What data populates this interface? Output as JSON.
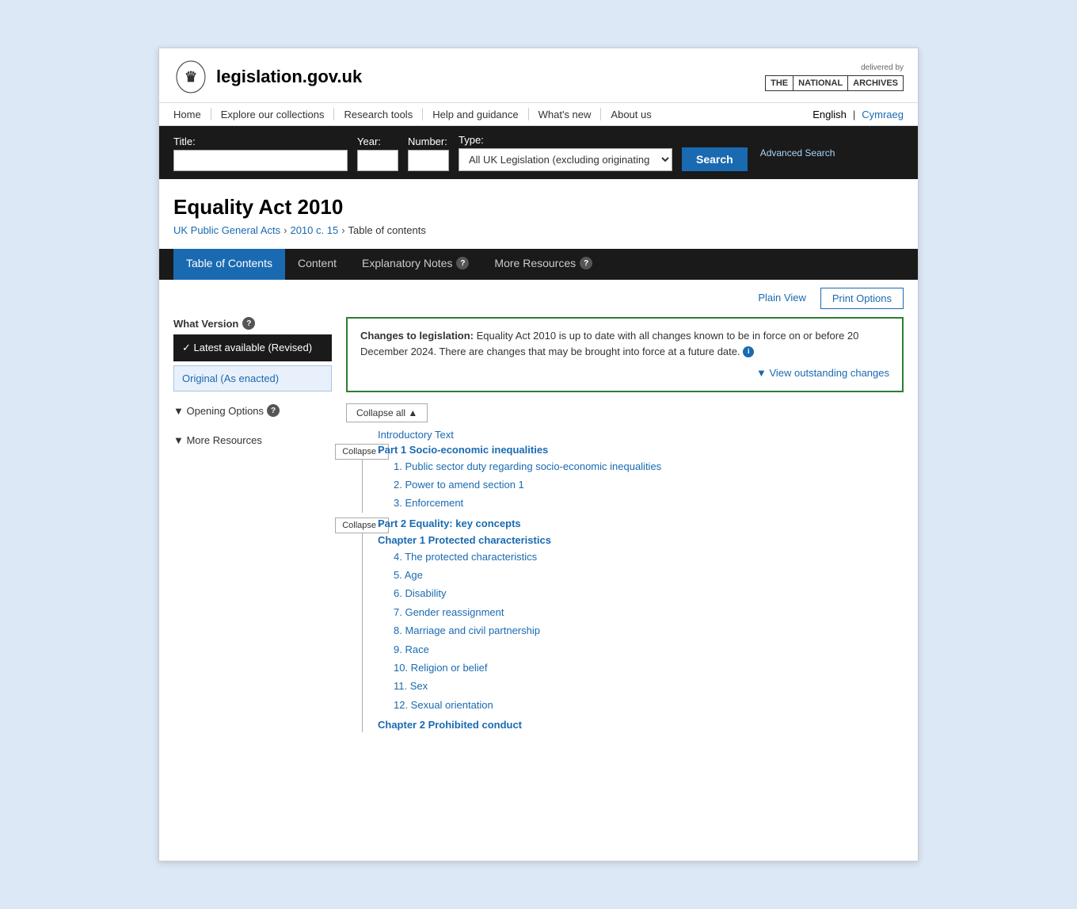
{
  "site": {
    "name_bold": "legislation",
    "name_rest": ".gov.uk",
    "delivered_by": "delivered by",
    "na_parts": [
      "THE",
      "NATIONAL",
      "ARCHIVES"
    ]
  },
  "nav": {
    "links": [
      "Home",
      "Explore our collections",
      "Research tools",
      "Help and guidance",
      "What's new",
      "About us"
    ],
    "lang_en": "English",
    "lang_cy": "Cymraeg"
  },
  "search": {
    "title_label": "Title:",
    "year_label": "Year:",
    "number_label": "Number:",
    "type_label": "Type:",
    "type_default": "All UK Legislation (excluding originating from the EU)",
    "search_btn": "Search",
    "advanced_link": "Advanced Search"
  },
  "page": {
    "title": "Equality Act 2010",
    "breadcrumb": [
      "UK Public General Acts",
      "2010 c. 15",
      "Table of contents"
    ]
  },
  "tabs": [
    {
      "label": "Table of Contents",
      "active": true,
      "help": false
    },
    {
      "label": "Content",
      "active": false,
      "help": false
    },
    {
      "label": "Explanatory Notes",
      "active": false,
      "help": true
    },
    {
      "label": "More Resources",
      "active": false,
      "help": true
    }
  ],
  "view_options": {
    "plain_view": "Plain View",
    "print_options": "Print Options"
  },
  "sidebar": {
    "what_version_label": "What Version",
    "version_latest": "✓ Latest available (Revised)",
    "version_original": "Original (As enacted)",
    "opening_options_label": "▼ Opening Options",
    "more_resources_label": "▼ More Resources"
  },
  "changes_box": {
    "title": "Changes to legislation:",
    "body": "Equality Act 2010 is up to date with all changes known to be in force on or before 20 December 2024. There are changes that may be brought into force at a future date.",
    "view_outstanding": "▼ View outstanding changes"
  },
  "toc": {
    "collapse_all": "Collapse all ▲",
    "collapse": "Collapse ▲",
    "introductory_text": "Introductory Text",
    "parts": [
      {
        "title": "Part 1 Socio-economic inequalities",
        "items": [
          "1. Public sector duty regarding socio-economic inequalities",
          "2. Power to amend section 1",
          "3. Enforcement"
        ],
        "chapters": []
      },
      {
        "title": "Part 2 Equality: key concepts",
        "items": [],
        "chapters": [
          {
            "title": "Chapter 1 Protected characteristics",
            "items": [
              "4. The protected characteristics",
              "5. Age",
              "6. Disability",
              "7. Gender reassignment",
              "8. Marriage and civil partnership",
              "9. Race",
              "10. Religion or belief",
              "11. Sex",
              "12. Sexual orientation"
            ]
          },
          {
            "title": "Chapter 2 Prohibited conduct",
            "items": []
          }
        ]
      }
    ]
  }
}
